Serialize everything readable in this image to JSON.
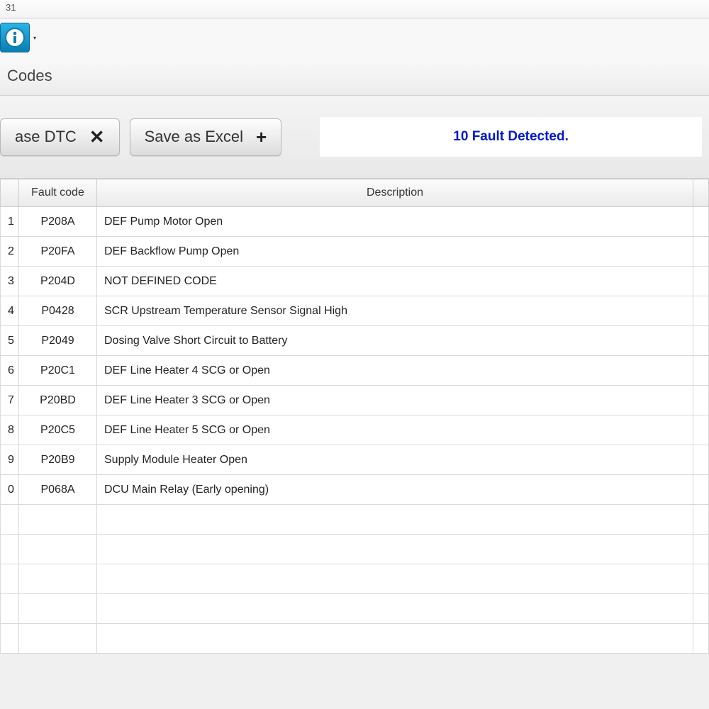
{
  "title_bar": "31",
  "page_label": "Codes",
  "buttons": {
    "erase_label": "ase DTC",
    "save_label": "Save as Excel"
  },
  "status_text": "10 Fault Detected.",
  "table": {
    "headers": {
      "num": "",
      "code": "Fault code",
      "desc": "Description",
      "extra": ""
    },
    "rows": [
      {
        "n": "1",
        "code": "P208A",
        "desc": "DEF Pump Motor Open"
      },
      {
        "n": "2",
        "code": "P20FA",
        "desc": "DEF Backflow Pump Open"
      },
      {
        "n": "3",
        "code": "P204D",
        "desc": "NOT DEFINED CODE"
      },
      {
        "n": "4",
        "code": "P0428",
        "desc": "SCR Upstream Temperature Sensor Signal High"
      },
      {
        "n": "5",
        "code": "P2049",
        "desc": "Dosing Valve Short Circuit to Battery"
      },
      {
        "n": "6",
        "code": "P20C1",
        "desc": "DEF Line Heater 4 SCG or Open"
      },
      {
        "n": "7",
        "code": "P20BD",
        "desc": "DEF Line Heater 3 SCG or Open"
      },
      {
        "n": "8",
        "code": "P20C5",
        "desc": "DEF Line Heater 5 SCG or Open"
      },
      {
        "n": "9",
        "code": "P20B9",
        "desc": "Supply Module Heater Open"
      },
      {
        "n": "0",
        "code": "P068A",
        "desc": "DCU Main Relay (Early opening)"
      }
    ],
    "empty_rows": 5
  }
}
